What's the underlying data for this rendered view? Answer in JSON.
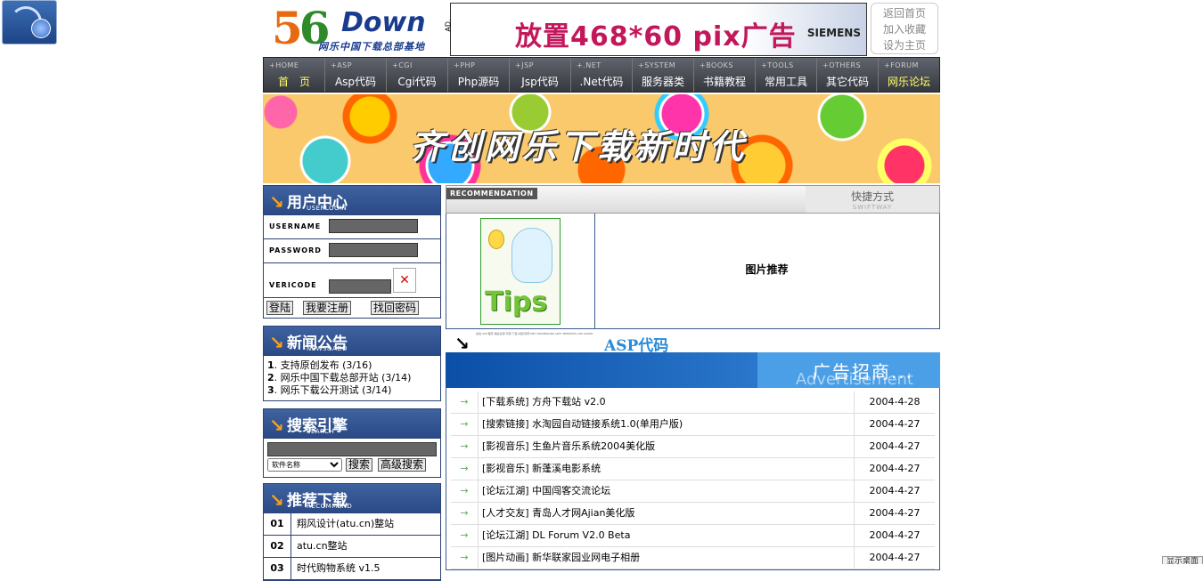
{
  "header": {
    "logo_main": "56",
    "logo_six": "6",
    "logo_five": "5",
    "logo_down": "Down",
    "logo_sub": "网乐中国下载总部基地",
    "ad_text": "放置468*60 pix广告",
    "ad_brand": "SIEMENS",
    "ad_tag": "AD.",
    "quick_links": [
      "返回首页",
      "加入收藏",
      "设为主页"
    ]
  },
  "nav": [
    {
      "en": "+HOME",
      "cn": "首　页",
      "hl": true
    },
    {
      "en": "+ASP",
      "cn": "Asp代码"
    },
    {
      "en": "+CGI",
      "cn": "Cgi代码"
    },
    {
      "en": "+PHP",
      "cn": "Php源码"
    },
    {
      "en": "+JSP",
      "cn": "Jsp代码"
    },
    {
      "en": "+.NET",
      "cn": ".Net代码"
    },
    {
      "en": "+SYSTEM",
      "cn": "服务器类"
    },
    {
      "en": "+BOOKS",
      "cn": "书籍教程"
    },
    {
      "en": "+TOOLS",
      "cn": "常用工具"
    },
    {
      "en": "+OTHERS",
      "cn": "其它代码"
    },
    {
      "en": "+FORUM",
      "cn": "网乐论坛",
      "hl": true
    }
  ],
  "banner": {
    "slogan": "齐创网乐下载新时代"
  },
  "login": {
    "title_cn": "用户中心",
    "title_en": "USERLOGIN",
    "username_label": "USERNAME",
    "password_label": "PASSWORD",
    "vericode_label": "VERICODE",
    "login_btn": "登陆",
    "register_btn": "我要注册",
    "recover_btn": "找回密码"
  },
  "news": {
    "title_cn": "新闻公告",
    "title_en": "NEWS&ADD",
    "items": [
      {
        "n": "1",
        "text": ". 支持原创发布 (3/16)"
      },
      {
        "n": "2",
        "text": ". 网乐中国下载总部开站 (3/14)"
      },
      {
        "n": "3",
        "text": ". 网乐下载公开测试 (3/14)"
      }
    ]
  },
  "search": {
    "title_cn": "搜索引擎",
    "title_en": "SEARCH",
    "select_value": "软件名称",
    "search_btn": "搜索",
    "advanced_btn": "高级搜索"
  },
  "recommend": {
    "title_cn": "推荐下载",
    "title_en": "RECOMMEND",
    "items": [
      {
        "idx": "01",
        "text": "翔风设计(atu.cn)整站"
      },
      {
        "idx": "02",
        "text": "atu.cn整站"
      },
      {
        "idx": "03",
        "text": "时代购物系统 v1.5"
      }
    ]
  },
  "pic_rec": {
    "tag": "RECOMMENDATION",
    "swift_cn": "快捷方式",
    "swift_en": "SWIFTWAY",
    "title": "图片推荐",
    "thumb_text": "Tips"
  },
  "asp": {
    "title_cn": "ASP代码",
    "fine_print": "在线 ASP 程序 相关资源 代码 下载 中国 网乐 NET FRAMEWORK SOFT PRESENTS ASP SCRIPT",
    "ad_cn": "广告招商...",
    "ad_en": "Advertisement",
    "rows": [
      {
        "name": "[下载系统] 方舟下载站 v2.0",
        "date": "2004-4-28"
      },
      {
        "name": "[搜索链接] 水淘园自动链接系统1.0(单用户版)",
        "date": "2004-4-27"
      },
      {
        "name": "[影视音乐] 生鱼片音乐系统2004美化版",
        "date": "2004-4-27"
      },
      {
        "name": "[影视音乐] 新蓬溪电影系统",
        "date": "2004-4-27"
      },
      {
        "name": "[论坛江湖] 中国闯客交流论坛",
        "date": "2004-4-27"
      },
      {
        "name": "[人才交友] 青岛人才网Ajian美化版",
        "date": "2004-4-27"
      },
      {
        "name": "[论坛江湖] DL Forum V2.0 Beta",
        "date": "2004-4-27"
      },
      {
        "name": "[图片动画] 新华联家园业网电子相册",
        "date": "2004-4-27"
      }
    ]
  },
  "corner": {
    "label": "显示桌面"
  }
}
